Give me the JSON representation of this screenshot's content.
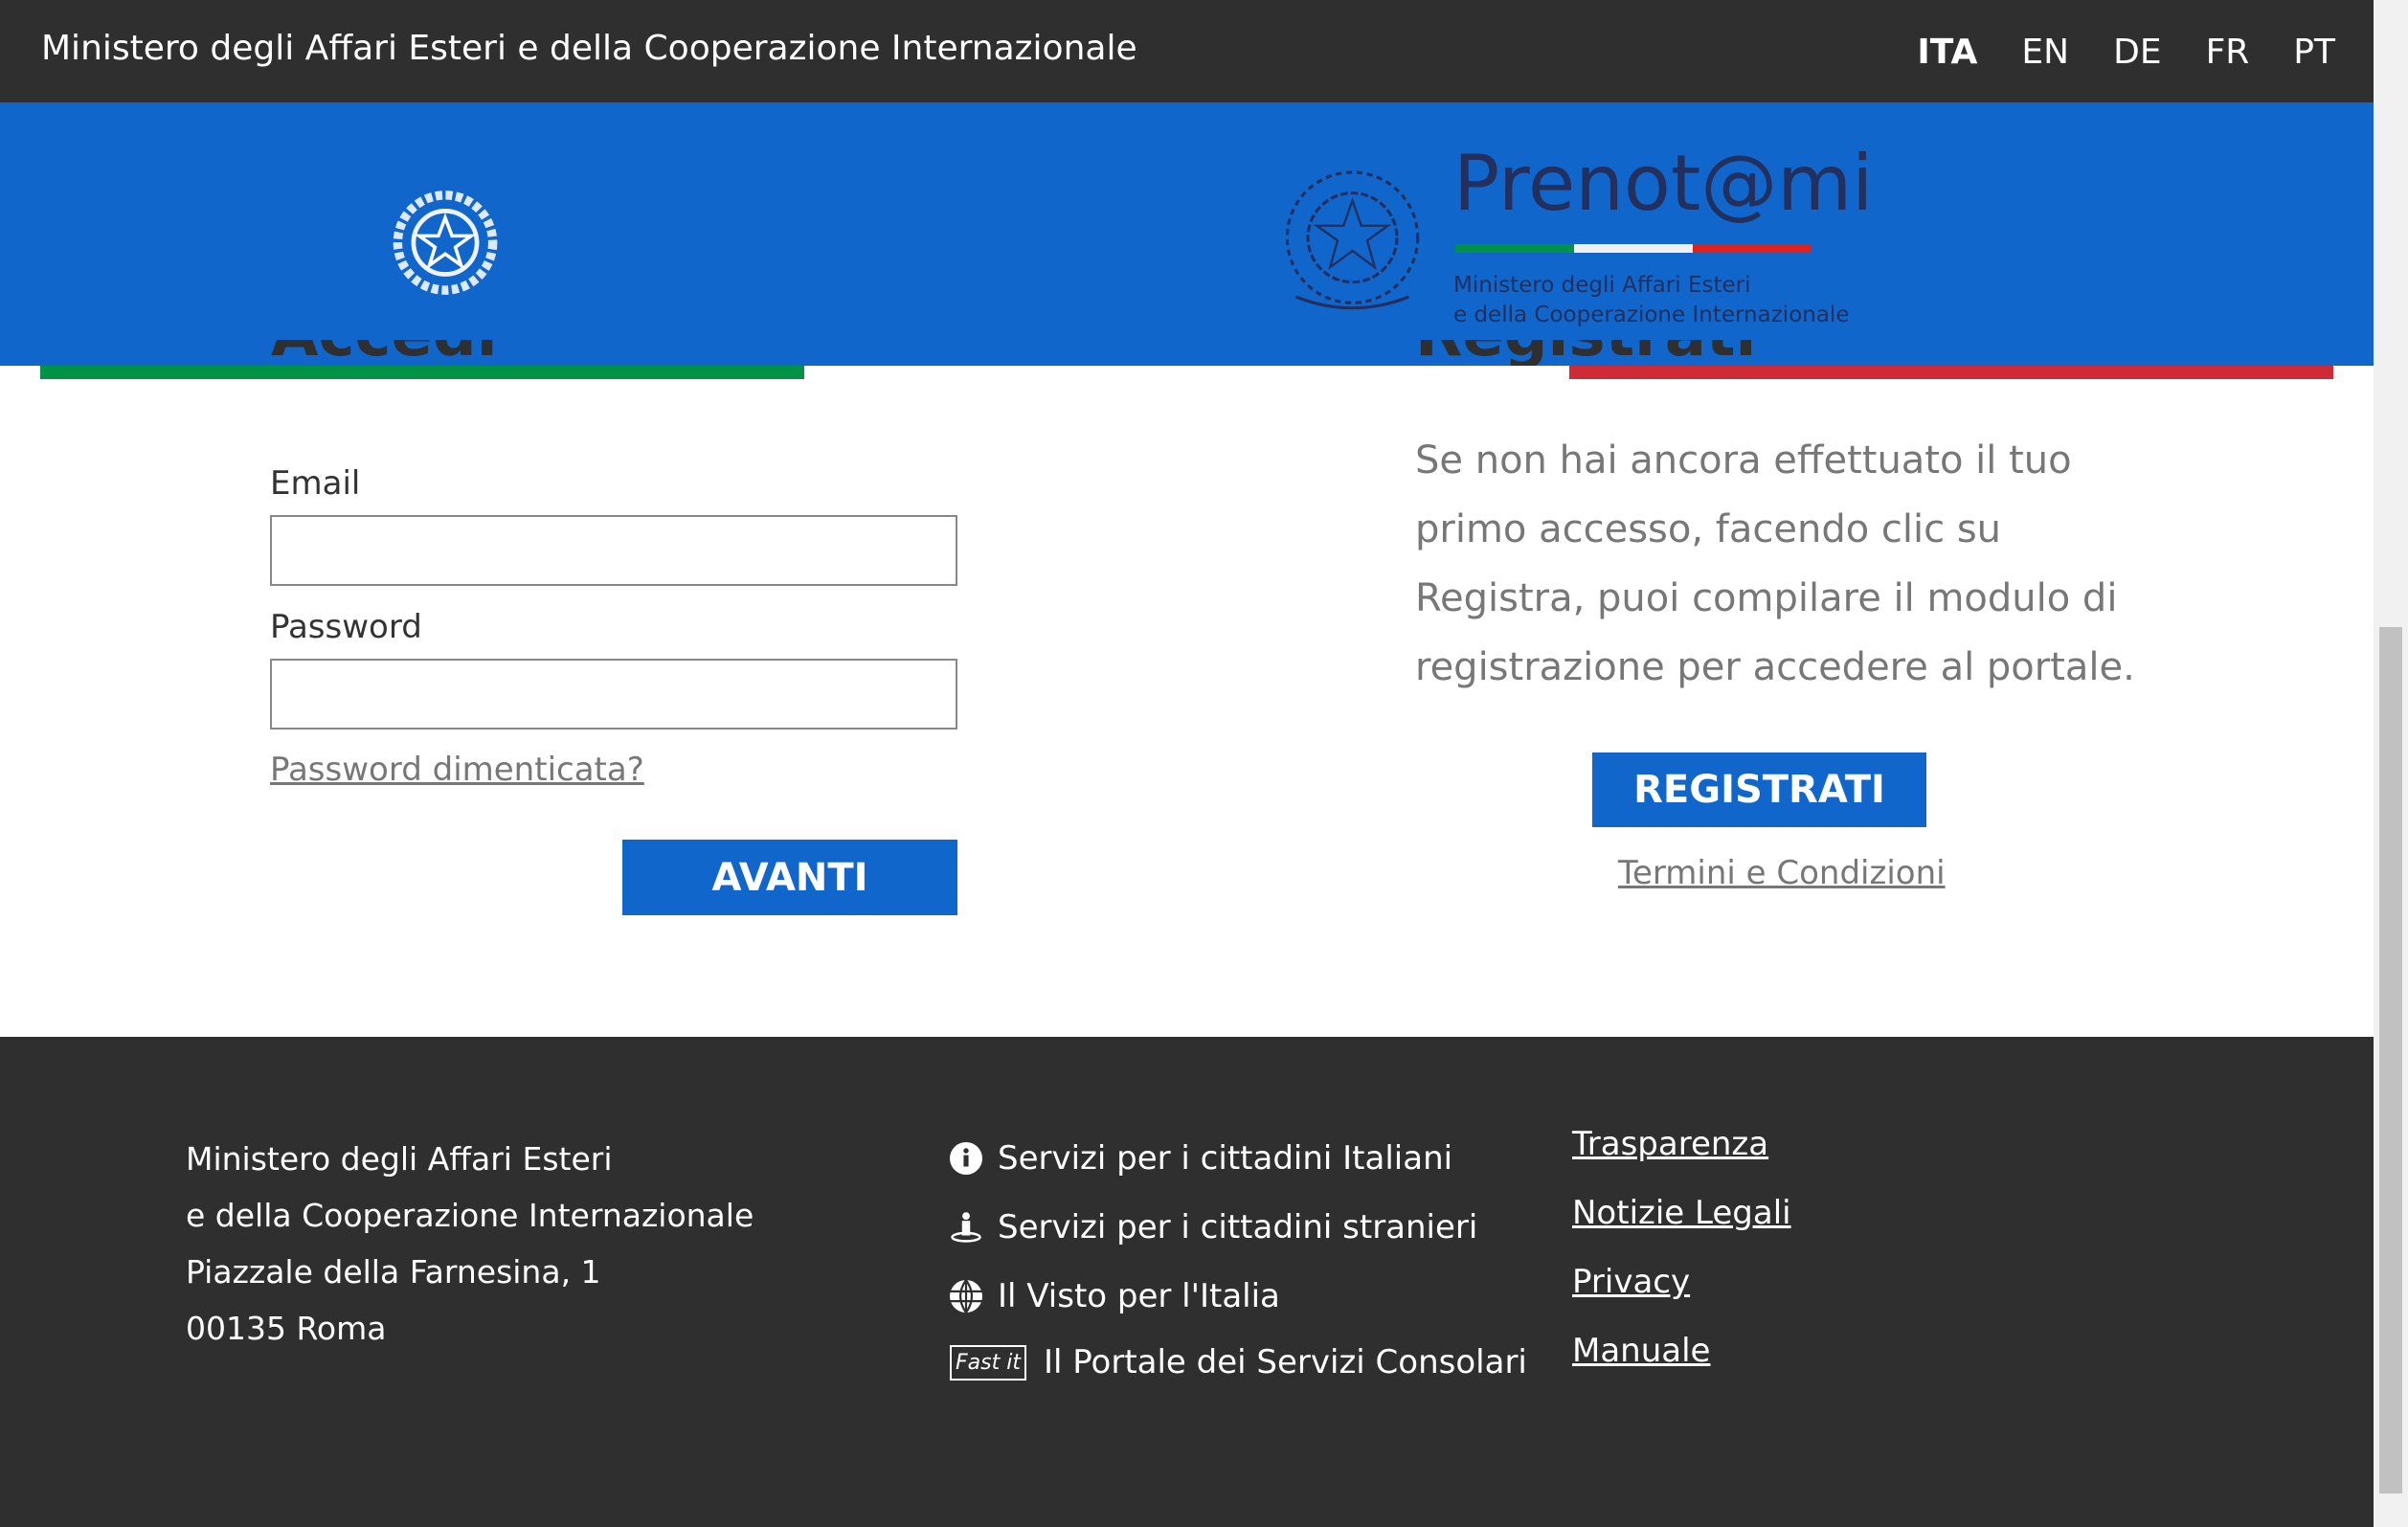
{
  "topbar": {
    "title": "Ministero degli Affari Esteri e della Cooperazione Internazionale",
    "languages": [
      "ITA",
      "EN",
      "DE",
      "FR",
      "PT"
    ],
    "active_language": "ITA"
  },
  "header": {
    "logo_text": "Prenot@mi",
    "logo_sub1": "Ministero degli Affari Esteri",
    "logo_sub2": "e della Cooperazione Internazionale"
  },
  "colors": {
    "blue": "#1066cb",
    "green": "#009246",
    "red": "#ce2b37",
    "dark": "#2f2f2f"
  },
  "login": {
    "heading": "Accedi",
    "email_label": "Email",
    "email_value": "",
    "password_label": "Password",
    "password_value": "",
    "forgot_link": "Password dimenticata?",
    "submit": "AVANTI"
  },
  "register": {
    "heading": "Registrati",
    "text": "Se non hai ancora effettuato il tuo primo accesso, facendo clic su Registra, puoi compilare il modulo di registrazione per accedere al portale.",
    "button": "REGISTRATI",
    "terms_link": "Termini e Condizioni"
  },
  "footer": {
    "address": [
      "Ministero degli Affari Esteri",
      "e della Cooperazione Internazionale",
      "Piazzale della Farnesina, 1",
      "00135 Roma"
    ],
    "services": [
      {
        "icon": "info-icon",
        "label": "Servizi per i cittadini Italiani"
      },
      {
        "icon": "person-pin-icon",
        "label": "Servizi per i cittadini stranieri"
      },
      {
        "icon": "globe-icon",
        "label": "Il Visto per l'Italia"
      },
      {
        "icon": "fastit-logo",
        "badge": "Fast it",
        "label": "Il Portale dei Servizi Consolari"
      }
    ],
    "links": [
      "Trasparenza",
      "Notizie Legali",
      "Privacy",
      "Manuale"
    ]
  }
}
